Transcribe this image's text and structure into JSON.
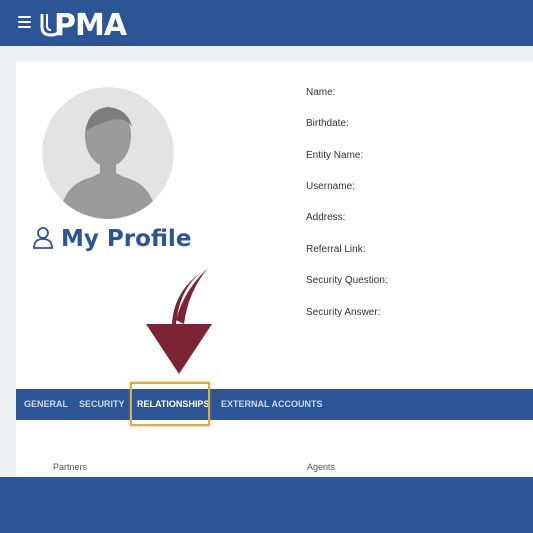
{
  "header": {
    "logo_text": "PMA",
    "menu_icon": "hamburger-menu-icon"
  },
  "profile": {
    "title": "My Profile",
    "fields": [
      {
        "label": "Name:"
      },
      {
        "label": "Birthdate:"
      },
      {
        "label": "Entity Name:"
      },
      {
        "label": "Username:"
      },
      {
        "label": "Address:"
      },
      {
        "label": "Referral Link:"
      },
      {
        "label": "Security Question:"
      },
      {
        "label": "Security Answer:"
      }
    ]
  },
  "tabs": [
    {
      "label": "GENERAL",
      "active": false
    },
    {
      "label": "SECURITY",
      "active": false
    },
    {
      "label": "RELATIONSHIPS",
      "active": true
    },
    {
      "label": "EXTERNAL ACCOUNTS",
      "active": false
    }
  ],
  "relationships": {
    "col1": "Partners",
    "col2": "Agents"
  },
  "colors": {
    "brand_blue": "#2b5597",
    "arrow": "#7d2434",
    "highlight": "#d6b04a"
  }
}
